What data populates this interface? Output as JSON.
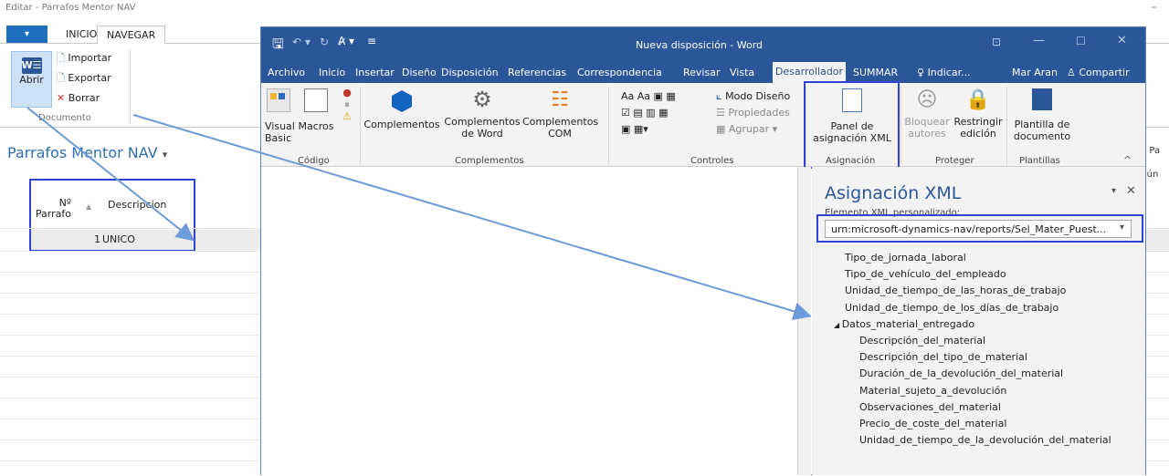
{
  "nav": {
    "title": "Editar - Parrafos Mentor NAV",
    "minimize": "–",
    "file_menu": "▾",
    "tabs": [
      "INICIO",
      "NAVEGAR"
    ],
    "abrir_label": "Abrir",
    "importar_label": "Importar",
    "exportar_label": "Exportar",
    "borrar_label": "Borrar",
    "group_label": "Documento",
    "page_title": "Parrafos Mentor NAV",
    "page_title_chevron": "▾",
    "table_headers": {
      "num": "Nº\nParrafo",
      "sort": "▲",
      "desc": "Descripcion"
    },
    "rows": [
      {
        "num": "1",
        "desc": "UNICO"
      }
    ],
    "right_stub_1": "Nº Pa",
    "right_stub_2": "ngún"
  },
  "word": {
    "title": "Nueva disposición - Word",
    "tabs": [
      "Archivo",
      "Inicio",
      "Insertar",
      "Diseño",
      "Disposición",
      "Referencias",
      "Correspondencia",
      "Revisar",
      "Vista",
      "Desarrollador",
      "SUMMAR"
    ],
    "tell_me": "Indicar...",
    "user": "Mar Aran",
    "share": "Compartir",
    "ribbon": {
      "codigo": {
        "label": "Código",
        "visual_basic": "Visual\nBasic",
        "macros": "Macros"
      },
      "complementos": {
        "label": "Complementos",
        "comp": "Complementos",
        "comp_word": "Complementos\nde Word",
        "comp_com": "Complementos\nCOM"
      },
      "controles": {
        "label": "Controles",
        "modo_diseno": "Modo Diseño",
        "propiedades": "Propiedades",
        "agrupar": "Agrupar"
      },
      "asignacion": {
        "label": "Asignación",
        "panel": "Panel de\nasignación XML"
      },
      "proteger": {
        "label": "Proteger",
        "bloquear": "Bloquear\nautores",
        "restringir": "Restringir\nedición"
      },
      "plantillas": {
        "label": "Plantillas",
        "plantilla": "Plantilla de\ndocumento"
      }
    },
    "xml_pane": {
      "title": "Asignación XML",
      "subtitle": "Elemento XML personalizado:",
      "selected": "urn:microsoft-dynamics-nav/reports/Sel_Mater_Puest...",
      "items": [
        {
          "text": "Tipo_de_jornada_laboral",
          "level": 1
        },
        {
          "text": "Tipo_de_vehículo_del_empleado",
          "level": 1
        },
        {
          "text": "Unidad_de_tiempo_de_las_horas_de_trabajo",
          "level": 1
        },
        {
          "text": "Unidad_de_tiempo_de_los_días_de_trabajo",
          "level": 1
        },
        {
          "text": "Datos_material_entregado",
          "level": 1,
          "expanded": true
        },
        {
          "text": "Descripción_del_material",
          "level": 2
        },
        {
          "text": "Descripción_del_tipo_de_material",
          "level": 2
        },
        {
          "text": "Duración_de_la_devolución_del_material",
          "level": 2
        },
        {
          "text": "Material_sujeto_a_devolución",
          "level": 2
        },
        {
          "text": "Observaciones_del_material",
          "level": 2
        },
        {
          "text": "Precio_de_coste_del_material",
          "level": 2
        },
        {
          "text": "Unidad_de_tiempo_de_la_devolución_del_material",
          "level": 2
        }
      ]
    }
  },
  "colors": {
    "word_blue": "#2b579a",
    "highlight_box": "#2f44d6",
    "arrow": "#6b9bd8"
  }
}
